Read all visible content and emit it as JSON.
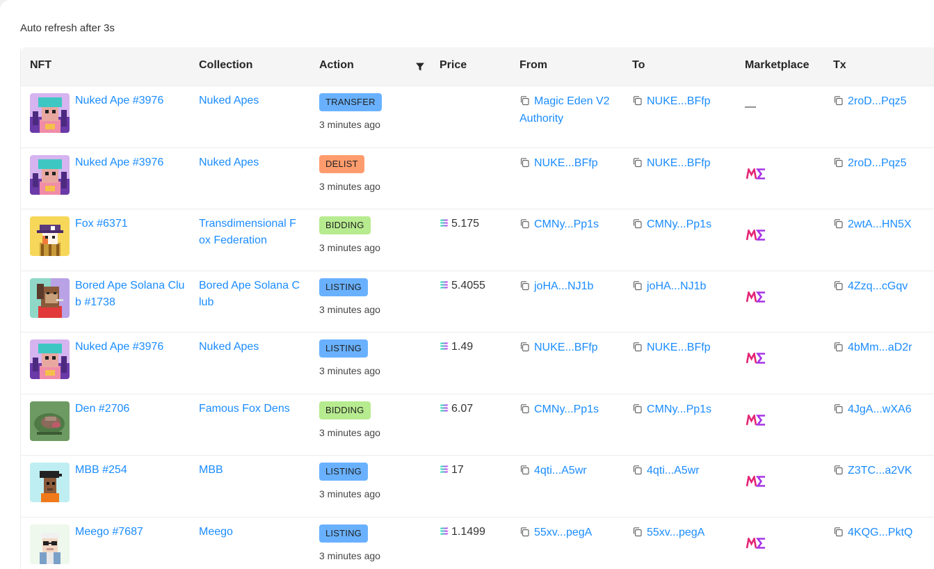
{
  "auto_refresh": "Auto refresh after 3s",
  "columns": {
    "nft": "NFT",
    "collection": "Collection",
    "action": "Action",
    "price": "Price",
    "from": "From",
    "to": "To",
    "marketplace": "Marketplace",
    "tx": "Tx"
  },
  "colors": {
    "link": "#1a8cff",
    "transfer": "#69b1ff",
    "delist": "#ff9c6e",
    "bidding": "#b7eb8f",
    "listing": "#69b1ff",
    "magic_eden": "#e42575"
  },
  "rows": [
    {
      "nft": "Nuked Ape #3976",
      "collection": "Nuked Apes",
      "action": "TRANSFER",
      "action_kind": "transfer",
      "time": "3 minutes ago",
      "price": "",
      "from": "Magic Eden V2 Authority",
      "to": "NUKE...BFfp",
      "marketplace": "—",
      "marketplace_logo": false,
      "tx": "2roD...Pqz5",
      "thumb": "nuked-ape"
    },
    {
      "nft": "Nuked Ape #3976",
      "collection": "Nuked Apes",
      "action": "DELIST",
      "action_kind": "delist",
      "time": "3 minutes ago",
      "price": "",
      "from": "NUKE...BFfp",
      "to": "NUKE...BFfp",
      "marketplace": "",
      "marketplace_logo": true,
      "tx": "2roD...Pqz5",
      "thumb": "nuked-ape"
    },
    {
      "nft": "Fox #6371",
      "collection": "Transdimensional Fox Federation",
      "action": "BIDDING",
      "action_kind": "bidding",
      "time": "3 minutes ago",
      "price": "5.175",
      "from": "CMNy...Pp1s",
      "to": "CMNy...Pp1s",
      "marketplace": "",
      "marketplace_logo": true,
      "tx": "2wtA...HN5X",
      "thumb": "fox"
    },
    {
      "nft": "Bored Ape Solana Club #1738",
      "collection": "Bored Ape Solana Club",
      "action": "LISTING",
      "action_kind": "listing",
      "time": "3 minutes ago",
      "price": "5.4055",
      "from": "joHA...NJ1b",
      "to": "joHA...NJ1b",
      "marketplace": "",
      "marketplace_logo": true,
      "tx": "4Zzq...cGqv",
      "thumb": "bored-ape"
    },
    {
      "nft": "Nuked Ape #3976",
      "collection": "Nuked Apes",
      "action": "LISTING",
      "action_kind": "listing",
      "time": "3 minutes ago",
      "price": "1.49",
      "from": "NUKE...BFfp",
      "to": "NUKE...BFfp",
      "marketplace": "",
      "marketplace_logo": true,
      "tx": "4bMm...aD2r",
      "thumb": "nuked-ape"
    },
    {
      "nft": "Den #2706",
      "collection": "Famous Fox Dens",
      "action": "BIDDING",
      "action_kind": "bidding",
      "time": "3 minutes ago",
      "price": "6.07",
      "from": "CMNy...Pp1s",
      "to": "CMNy...Pp1s",
      "marketplace": "",
      "marketplace_logo": true,
      "tx": "4JgA...wXA6",
      "thumb": "den"
    },
    {
      "nft": "MBB #254",
      "collection": "MBB",
      "action": "LISTING",
      "action_kind": "listing",
      "time": "3 minutes ago",
      "price": "17",
      "from": "4qti...A5wr",
      "to": "4qti...A5wr",
      "marketplace": "",
      "marketplace_logo": true,
      "tx": "Z3TC...a2VK",
      "thumb": "mbb"
    },
    {
      "nft": "Meego #7687",
      "collection": "Meego",
      "action": "LISTING",
      "action_kind": "listing",
      "time": "3 minutes ago",
      "price": "1.1499",
      "from": "55xv...pegA",
      "to": "55xv...pegA",
      "marketplace": "",
      "marketplace_logo": true,
      "tx": "4KQG...PktQ",
      "thumb": "meego"
    }
  ]
}
